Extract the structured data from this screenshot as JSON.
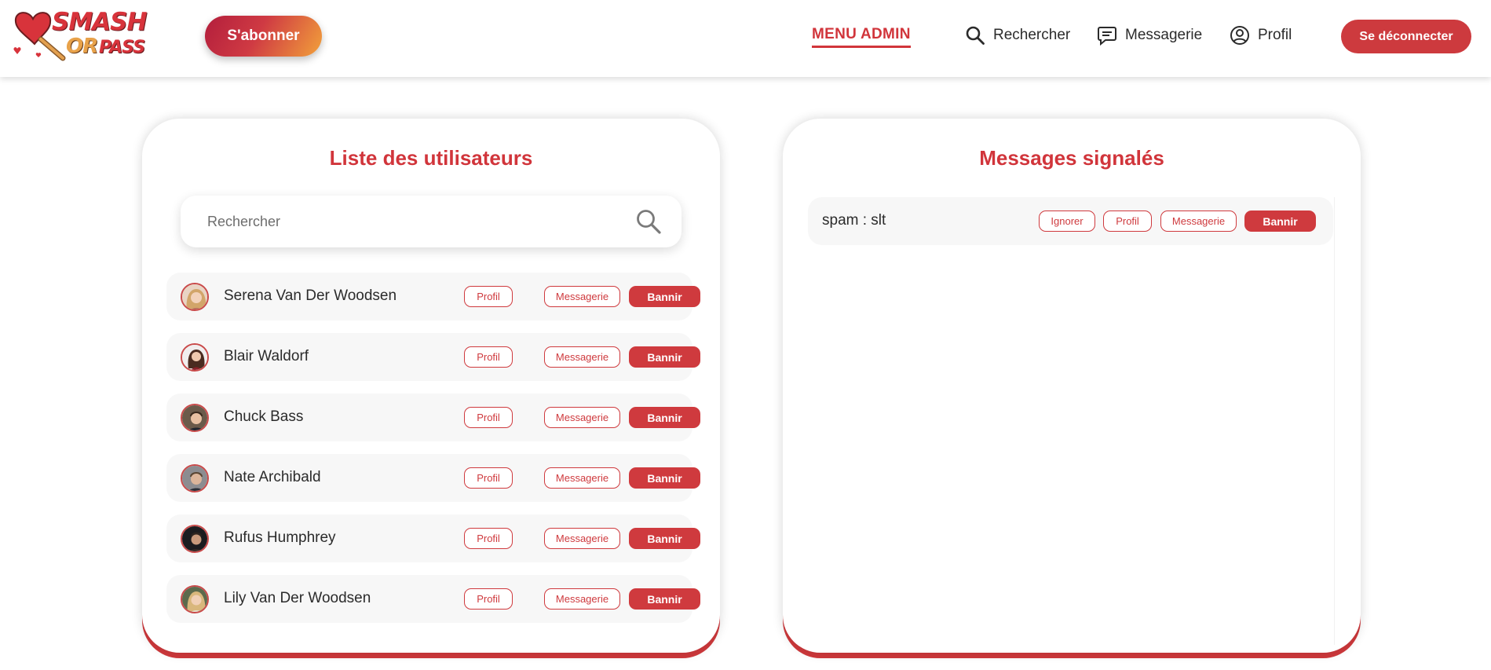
{
  "brand": {
    "logo_line1": "SMASH",
    "logo_line2": "OR",
    "logo_line3": "PASS",
    "color_primary": "#d1353b",
    "color_accent": "#f2a13a"
  },
  "header": {
    "subscribe_label": "S'abonner",
    "nav": {
      "admin": "MENU ADMIN",
      "search": "Rechercher",
      "search_icon": "search-icon",
      "messages": "Messagerie",
      "messages_icon": "chat-icon",
      "profile": "Profil",
      "profile_icon": "user-circle-icon"
    },
    "logout_label": "Se déconnecter"
  },
  "users_panel": {
    "title": "Liste des utilisateurs",
    "search_placeholder": "Rechercher",
    "search_value": "",
    "users": [
      {
        "name": "Serena Van Der Woodsen",
        "profile_label": "Profil",
        "message_label": "Messagerie",
        "ban_label": "Bannir"
      },
      {
        "name": "Blair Waldorf",
        "profile_label": "Profil",
        "message_label": "Messagerie",
        "ban_label": "Bannir"
      },
      {
        "name": "Chuck Bass",
        "profile_label": "Profil",
        "message_label": "Messagerie",
        "ban_label": "Bannir"
      },
      {
        "name": "Nate Archibald",
        "profile_label": "Profil",
        "message_label": "Messagerie",
        "ban_label": "Bannir"
      },
      {
        "name": "Rufus Humphrey",
        "profile_label": "Profil",
        "message_label": "Messagerie",
        "ban_label": "Bannir"
      },
      {
        "name": "Lily Van Der Woodsen",
        "profile_label": "Profil",
        "message_label": "Messagerie",
        "ban_label": "Bannir"
      }
    ]
  },
  "reports_panel": {
    "title": "Messages signalés",
    "reports": [
      {
        "text": "spam : slt",
        "ignore_label": "Ignorer",
        "profile_label": "Profil",
        "message_label": "Messagerie",
        "ban_label": "Bannir"
      }
    ]
  }
}
